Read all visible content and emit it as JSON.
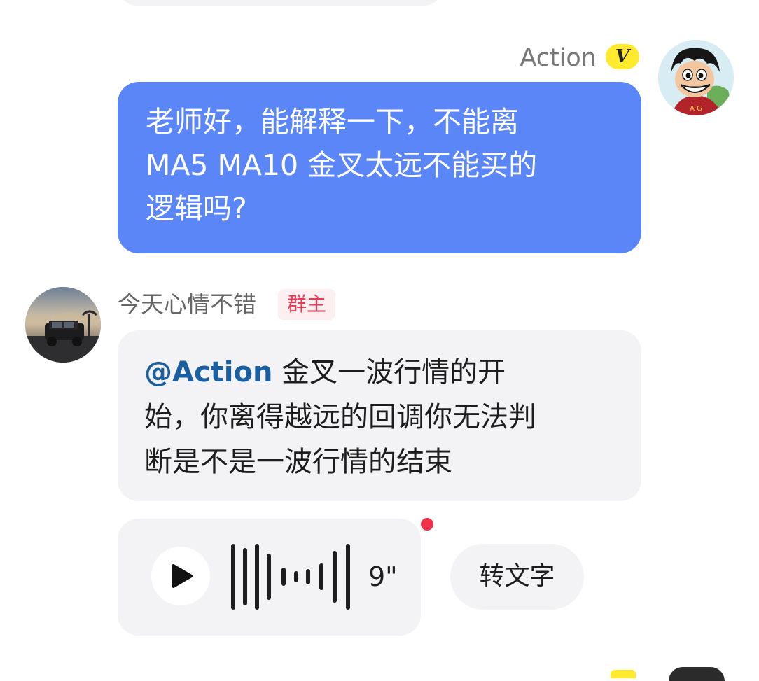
{
  "messages": {
    "outgoing": {
      "sender_name": "Action",
      "verified_badge": "V",
      "avatar_icon": "cartoon-avatar",
      "lines": [
        "老师好，能解释一下，不能离",
        "MA5 MA10 金叉太远不能买的",
        "逻辑吗?"
      ],
      "bubble_color": "#5a86f8"
    },
    "incoming": {
      "sender_name": "今天心情不错",
      "role_badge": "群主",
      "avatar_icon": "car-photo-avatar",
      "mention": "@Action",
      "line1_rest": " 金叉一波行情的开",
      "line2": "始，你离得越远的回调你无法判",
      "line3": "断是不是一波行情的结束"
    },
    "voice": {
      "duration": "9\"",
      "transcribe_label": "转文字",
      "play_icon": "play-icon",
      "waveform_icon": "waveform-icon",
      "unread_color": "#f0334b"
    }
  },
  "colors": {
    "bubble_gray": "#f3f3f5",
    "mention": "#1b5fa0",
    "verified": "#ffea2e",
    "owner_badge_text": "#e23b56"
  }
}
